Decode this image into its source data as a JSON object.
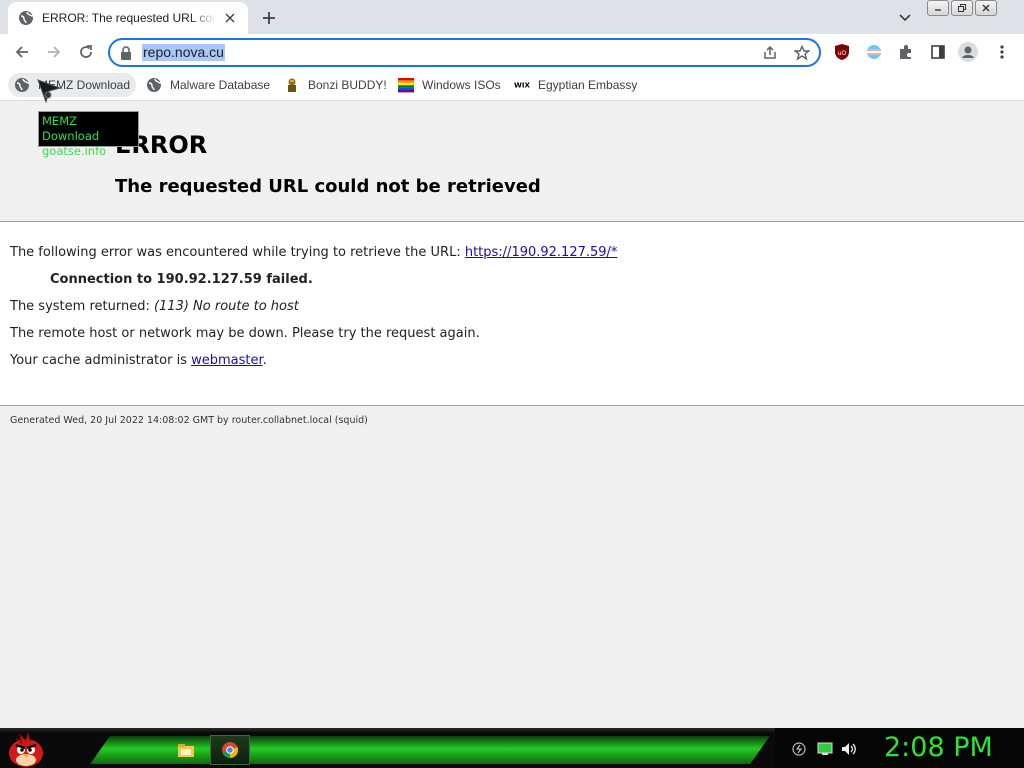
{
  "browser": {
    "tab": {
      "title": "ERROR: The requested URL could not be retrieved",
      "favicon": "globe-icon"
    },
    "omnibox": {
      "url": "repo.nova.cu"
    }
  },
  "bookmarks": [
    {
      "label": "MEMZ Download",
      "icon": "globe-icon"
    },
    {
      "label": "Malware Database",
      "icon": "globe-icon"
    },
    {
      "label": "Bonzi BUDDY!",
      "icon": "bonzi-icon"
    },
    {
      "label": "Windows ISOs",
      "icon": "windows-flag-icon"
    },
    {
      "label": "Egyptian Embassy",
      "icon": "wix-icon"
    }
  ],
  "tooltip": {
    "line1": "MEMZ Download",
    "line2": "goatse.info"
  },
  "page": {
    "heading": "ERROR",
    "subheading": "The requested URL could not be retrieved",
    "encountered": "The following error was encountered while trying to retrieve the URL: ",
    "link_url": "https://190.92.127.59/*",
    "connection": "Connection to 190.92.127.59 failed.",
    "system_label": "The system returned: ",
    "system_error": "(113) No route to host",
    "remote_msg": "The remote host or network may be down. Please try the request again.",
    "cache_admin": "Your cache administrator is ",
    "webmaster": "webmaster",
    "period": ".",
    "footer": "Generated Wed, 20 Jul 2022 14:08:02 GMT by router.collabnet.local (squid)"
  },
  "taskbar": {
    "clock": "2:08 PM",
    "items": [
      "file-explorer-icon",
      "chrome-icon"
    ],
    "tray": [
      "network-icon",
      "monitor-icon",
      "volume-icon"
    ]
  },
  "colors": {
    "accent": "#1a73e8",
    "link": "#1a0dab",
    "clock": "#2ee32e",
    "tooltip_text": "#2fe04a"
  }
}
